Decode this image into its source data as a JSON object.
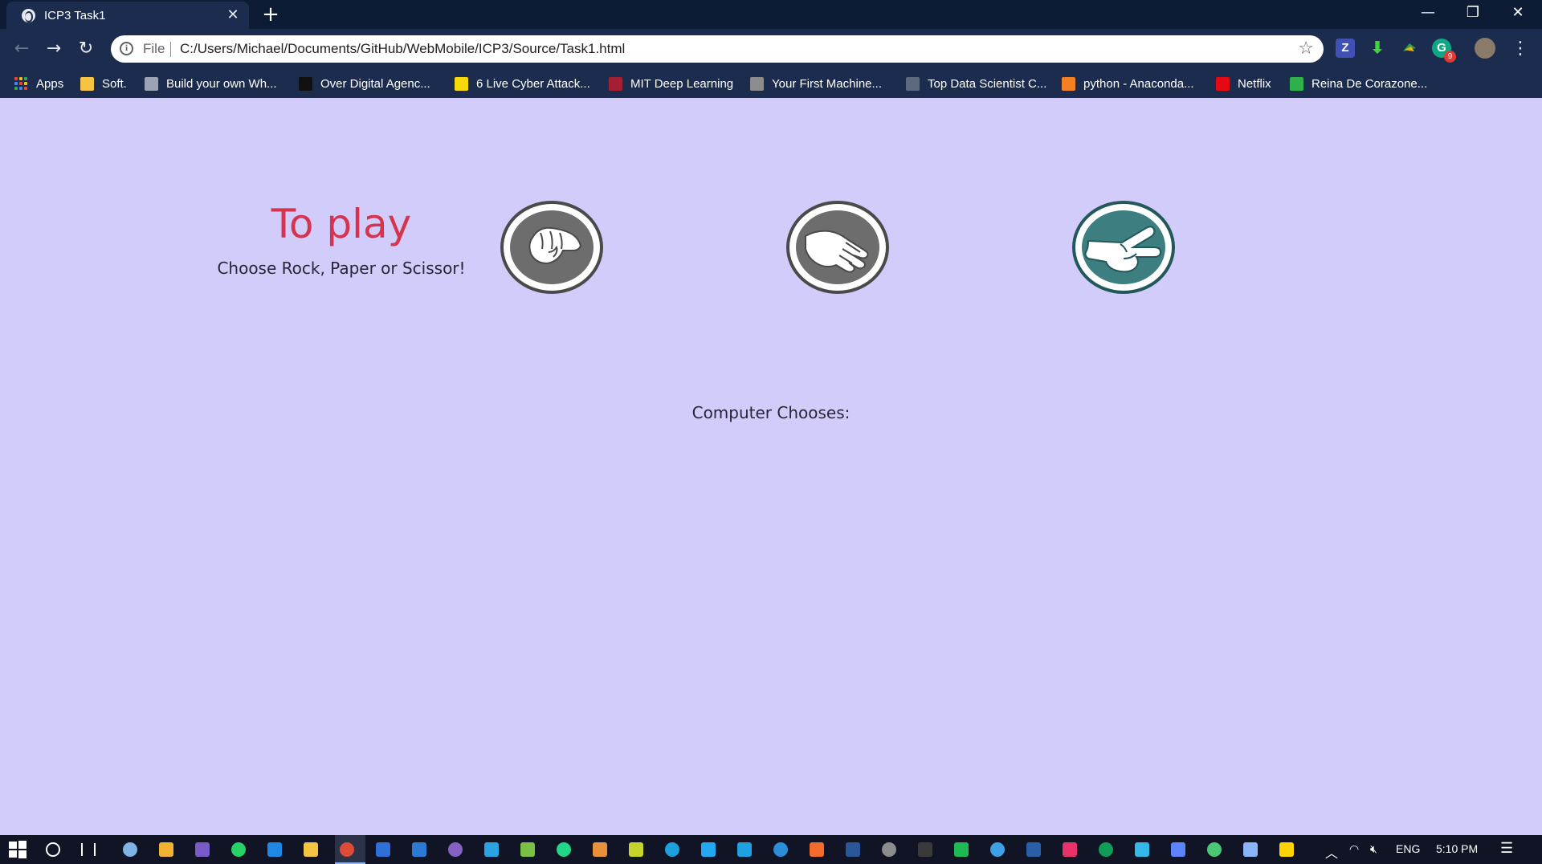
{
  "browser": {
    "tab_title": "ICP3 Task1",
    "url_scheme": "File",
    "url": "C:/Users/Michael/Documents/GitHub/WebMobile/ICP3/Source/Task1.html",
    "ext_z": "Z",
    "ext_badge": "9",
    "bookmarks": [
      {
        "label": "Apps",
        "color": "#ea4335"
      },
      {
        "label": "Soft.",
        "color": "#f6c342"
      },
      {
        "label": "Build your own Wh...",
        "color": "#9aa4b5"
      },
      {
        "label": "Over Digital Agenc...",
        "color": "#111111"
      },
      {
        "label": "6 Live Cyber Attack...",
        "color": "#f5d90a"
      },
      {
        "label": "MIT Deep Learning",
        "color": "#a31f34"
      },
      {
        "label": "Your First Machine...",
        "color": "#8c8c8c"
      },
      {
        "label": "Top Data Scientist C...",
        "color": "#5b6b7d"
      },
      {
        "label": "python - Anaconda...",
        "color": "#f48024"
      },
      {
        "label": "Netflix",
        "color": "#e50914"
      },
      {
        "label": "Reina De Corazone...",
        "color": "#2fb04a"
      }
    ]
  },
  "game": {
    "heading": "To play",
    "subheading": "Choose Rock, Paper or Scissor!",
    "computer_label": "Computer Chooses:",
    "choices": [
      {
        "name": "rock",
        "icon": "rock-fist-icon",
        "color": "#6d6d6d"
      },
      {
        "name": "paper",
        "icon": "paper-hand-icon",
        "color": "#6d6d6d"
      },
      {
        "name": "scissor",
        "icon": "scissor-hand-icon",
        "color": "#3d7f80"
      }
    ],
    "heading_color": "#d5334e",
    "background_color": "#d2ccfb"
  },
  "taskbar": {
    "language": "ENG",
    "time": "5:10 PM"
  }
}
